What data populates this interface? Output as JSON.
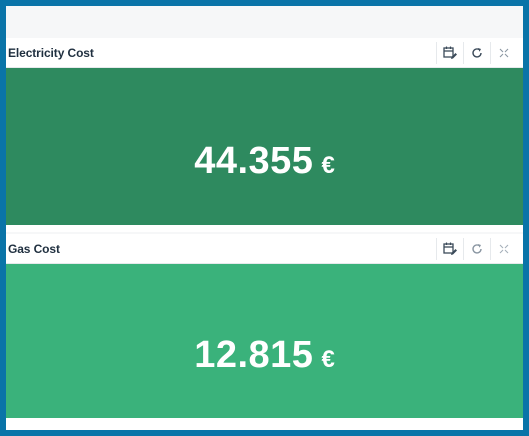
{
  "panels": [
    {
      "title": "Electricity Cost",
      "value": "44.355",
      "unit": "€",
      "color": "#2e8a5f",
      "tools": [
        "calendar-edit-icon",
        "refresh-icon",
        "expand-icon"
      ]
    },
    {
      "title": "Gas Cost",
      "value": "12.815",
      "unit": "€",
      "color": "#3ab27b",
      "tools": [
        "calendar-edit-icon",
        "refresh-icon",
        "expand-icon"
      ]
    }
  ],
  "colors": {
    "frame_border": "#0a74a8",
    "header_bg": "#ffffff",
    "title_text": "#1f2f3f",
    "value_text": "#ffffff"
  }
}
